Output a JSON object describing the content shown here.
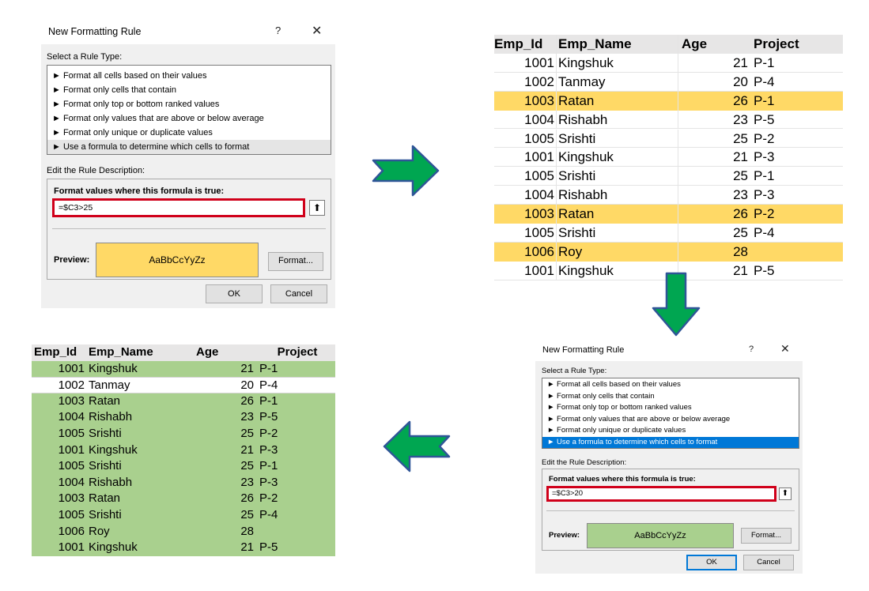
{
  "dialog_1": {
    "title": "New Formatting Rule",
    "help_glyph": "?",
    "close_glyph": "✕",
    "select_rule_type_label": "Select a Rule Type:",
    "rule_types": [
      "► Format all cells based on their values",
      "► Format only cells that contain",
      "► Format only top or bottom ranked values",
      "► Format only values that are above or below average",
      "► Format only unique or duplicate values",
      "► Use a formula to determine which cells to format"
    ],
    "selected_rule_index": 5,
    "edit_description_label": "Edit the Rule Description:",
    "formula_header": "Format values where this formula is true:",
    "formula_value": "=$C3>25",
    "preview_label": "Preview:",
    "preview_sample": "AaBbCcYyZz",
    "preview_fill_color": "#ffd966",
    "format_button": "Format...",
    "ok_button": "OK",
    "cancel_button": "Cancel"
  },
  "dialog_2": {
    "title": "New Formatting Rule",
    "help_glyph": "?",
    "close_glyph": "✕",
    "select_rule_type_label": "Select a Rule Type:",
    "rule_types": [
      "► Format all cells based on their values",
      "► Format only cells that contain",
      "► Format only top or bottom ranked values",
      "► Format only values that are above or below average",
      "► Format only unique or duplicate values",
      "► Use a formula to determine which cells to format"
    ],
    "selected_rule_index": 5,
    "edit_description_label": "Edit the Rule Description:",
    "formula_header": "Format values where this formula is true:",
    "formula_value": "=$C3>20",
    "preview_label": "Preview:",
    "preview_sample": "AaBbCcYyZz",
    "preview_fill_color": "#a9d08e",
    "format_button": "Format...",
    "ok_button": "OK",
    "cancel_button": "Cancel"
  },
  "sheet_1": {
    "headers": [
      "Emp_Id",
      "Emp_Name",
      "Age",
      "Project"
    ],
    "highlight_color": "#ffd966",
    "rows": [
      {
        "id": "1001",
        "name": "Kingshuk",
        "age": "21",
        "project": "P-1",
        "hl": false
      },
      {
        "id": "1002",
        "name": "Tanmay",
        "age": "20",
        "project": "P-4",
        "hl": false
      },
      {
        "id": "1003",
        "name": "Ratan",
        "age": "26",
        "project": "P-1",
        "hl": true
      },
      {
        "id": "1004",
        "name": "Rishabh",
        "age": "23",
        "project": "P-5",
        "hl": false
      },
      {
        "id": "1005",
        "name": "Srishti",
        "age": "25",
        "project": "P-2",
        "hl": false
      },
      {
        "id": "1001",
        "name": "Kingshuk",
        "age": "21",
        "project": "P-3",
        "hl": false
      },
      {
        "id": "1005",
        "name": "Srishti",
        "age": "25",
        "project": "P-1",
        "hl": false
      },
      {
        "id": "1004",
        "name": "Rishabh",
        "age": "23",
        "project": "P-3",
        "hl": false
      },
      {
        "id": "1003",
        "name": "Ratan",
        "age": "26",
        "project": "P-2",
        "hl": true
      },
      {
        "id": "1005",
        "name": "Srishti",
        "age": "25",
        "project": "P-4",
        "hl": false
      },
      {
        "id": "1006",
        "name": "Roy",
        "age": "28",
        "project": "",
        "hl": true
      },
      {
        "id": "1001",
        "name": "Kingshuk",
        "age": "21",
        "project": "P-5",
        "hl": false
      }
    ]
  },
  "sheet_2": {
    "headers": [
      "Emp_Id",
      "Emp_Name",
      "Age",
      "Project"
    ],
    "highlight_color": "#a9d08e",
    "rows": [
      {
        "id": "1001",
        "name": "Kingshuk",
        "age": "21",
        "project": "P-1",
        "hl": true
      },
      {
        "id": "1002",
        "name": "Tanmay",
        "age": "20",
        "project": "P-4",
        "hl": false
      },
      {
        "id": "1003",
        "name": "Ratan",
        "age": "26",
        "project": "P-1",
        "hl": true
      },
      {
        "id": "1004",
        "name": "Rishabh",
        "age": "23",
        "project": "P-5",
        "hl": true
      },
      {
        "id": "1005",
        "name": "Srishti",
        "age": "25",
        "project": "P-2",
        "hl": true
      },
      {
        "id": "1001",
        "name": "Kingshuk",
        "age": "21",
        "project": "P-3",
        "hl": true
      },
      {
        "id": "1005",
        "name": "Srishti",
        "age": "25",
        "project": "P-1",
        "hl": true
      },
      {
        "id": "1004",
        "name": "Rishabh",
        "age": "23",
        "project": "P-3",
        "hl": true
      },
      {
        "id": "1003",
        "name": "Ratan",
        "age": "26",
        "project": "P-2",
        "hl": true
      },
      {
        "id": "1005",
        "name": "Srishti",
        "age": "25",
        "project": "P-4",
        "hl": true
      },
      {
        "id": "1006",
        "name": "Roy",
        "age": "28",
        "project": "",
        "hl": true
      },
      {
        "id": "1001",
        "name": "Kingshuk",
        "age": "21",
        "project": "P-5",
        "hl": true
      }
    ]
  },
  "arrows": {
    "fill_color": "#00a651",
    "outline_color": "#2f5597",
    "directions": [
      "right",
      "down",
      "left"
    ]
  }
}
